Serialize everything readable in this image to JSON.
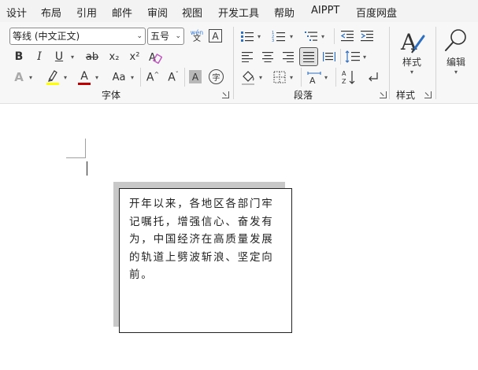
{
  "menu": {
    "items": [
      "设计",
      "布局",
      "引用",
      "邮件",
      "审阅",
      "视图",
      "开发工具",
      "帮助",
      "AIPPT",
      "百度网盘"
    ]
  },
  "ribbon": {
    "font_name": "等线 (中文正文)",
    "font_size": "五号",
    "phonetic_top": "wén",
    "phonetic_bottom": "文",
    "char_border": "A",
    "bold": "B",
    "italic": "I",
    "underline": "U",
    "strike": "ab",
    "subscript": "x₂",
    "superscript": "x²",
    "change_case": "Aa",
    "grow_font": "A^",
    "shrink_font": "Aˇ",
    "char_shading": "A",
    "enclose_char": "字",
    "styles_label": "样式",
    "edit_label": "编辑",
    "groups": {
      "font": "字体",
      "paragraph": "段落",
      "styles": "样式"
    },
    "colors": {
      "highlight": "#ffff00",
      "font_color": "#c00000"
    }
  },
  "document": {
    "textbox_text": "开年以来，各地区各部门牢记嘱托，增强信心、奋发有为，中国经济在高质量发展的轨道上劈波斩浪、坚定向前。"
  }
}
